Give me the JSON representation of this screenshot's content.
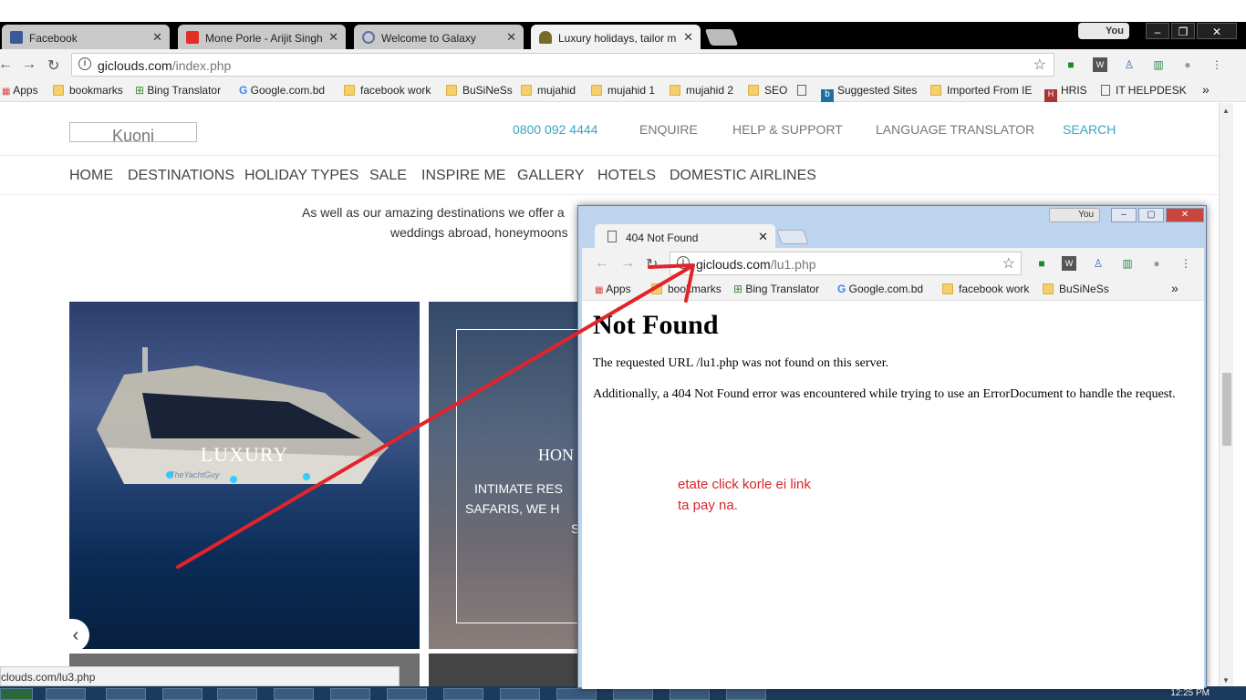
{
  "browser": {
    "tabs": [
      {
        "title": "Facebook"
      },
      {
        "title": "Mone Porle - Arijit Singh"
      },
      {
        "title": "Welcome to Galaxy"
      },
      {
        "title": "Luxury holidays, tailor m"
      }
    ],
    "user_badge": "You",
    "address": {
      "host": "giclouds.com",
      "path": "/index.php"
    },
    "bookmarks": [
      "Apps",
      "bookmarks",
      "Bing Translator",
      "Google.com.bd",
      "facebook work",
      "BuSiNeSs",
      "mujahid",
      "mujahid 1",
      "mujahid 2",
      "SEO",
      "",
      "Suggested Sites",
      "Imported From IE",
      "HRIS",
      "IT HELPDESK"
    ],
    "more_bookmarks": "»",
    "status_url": "clouds.com/lu3.php",
    "accent_color": "#3aa6c0"
  },
  "site": {
    "logo_alt": "Kuoni",
    "phone": "0800 092 4444",
    "top_links": [
      "ENQUIRE",
      "HELP & SUPPORT",
      "LANGUAGE TRANSLATOR",
      "SEARCH"
    ],
    "menu": [
      "HOME",
      "DESTINATIONS",
      "HOLIDAY TYPES",
      "SALE",
      "INSPIRE ME",
      "GALLERY",
      "HOTELS",
      "DOMESTIC AIRLINES"
    ],
    "intro_line1": "As well as our amazing destinations we offer a",
    "intro_line2": "weddings abroad, honeymoons",
    "cards": [
      {
        "label": "LUXURY",
        "watermark": "TheYachtGuy"
      },
      {
        "label": "HON",
        "text_lines": [
          "INTIMATE RES",
          "SAFARIS, WE H",
          "S"
        ]
      }
    ],
    "prev_arrow": "‹"
  },
  "popup": {
    "tab_title": "404 Not Found",
    "user_badge": "You",
    "address": {
      "host": "giclouds.com",
      "path": "/lu1.php"
    },
    "bookmarks": [
      "Apps",
      "bookmarks",
      "Bing Translator",
      "Google.com.bd",
      "facebook work",
      "BuSiNeSs"
    ],
    "more_bookmarks": "»",
    "heading": "Not Found",
    "para1": "The requested URL /lu1.php was not found on this server.",
    "para2": "Additionally, a 404 Not Found error was encountered while trying to use an ErrorDocument to handle the request.",
    "annotation": "etate click korle ei link\nta pay na.",
    "annotation_color": "#d6252a"
  },
  "taskbar": {
    "clock": "12:25 PM"
  }
}
